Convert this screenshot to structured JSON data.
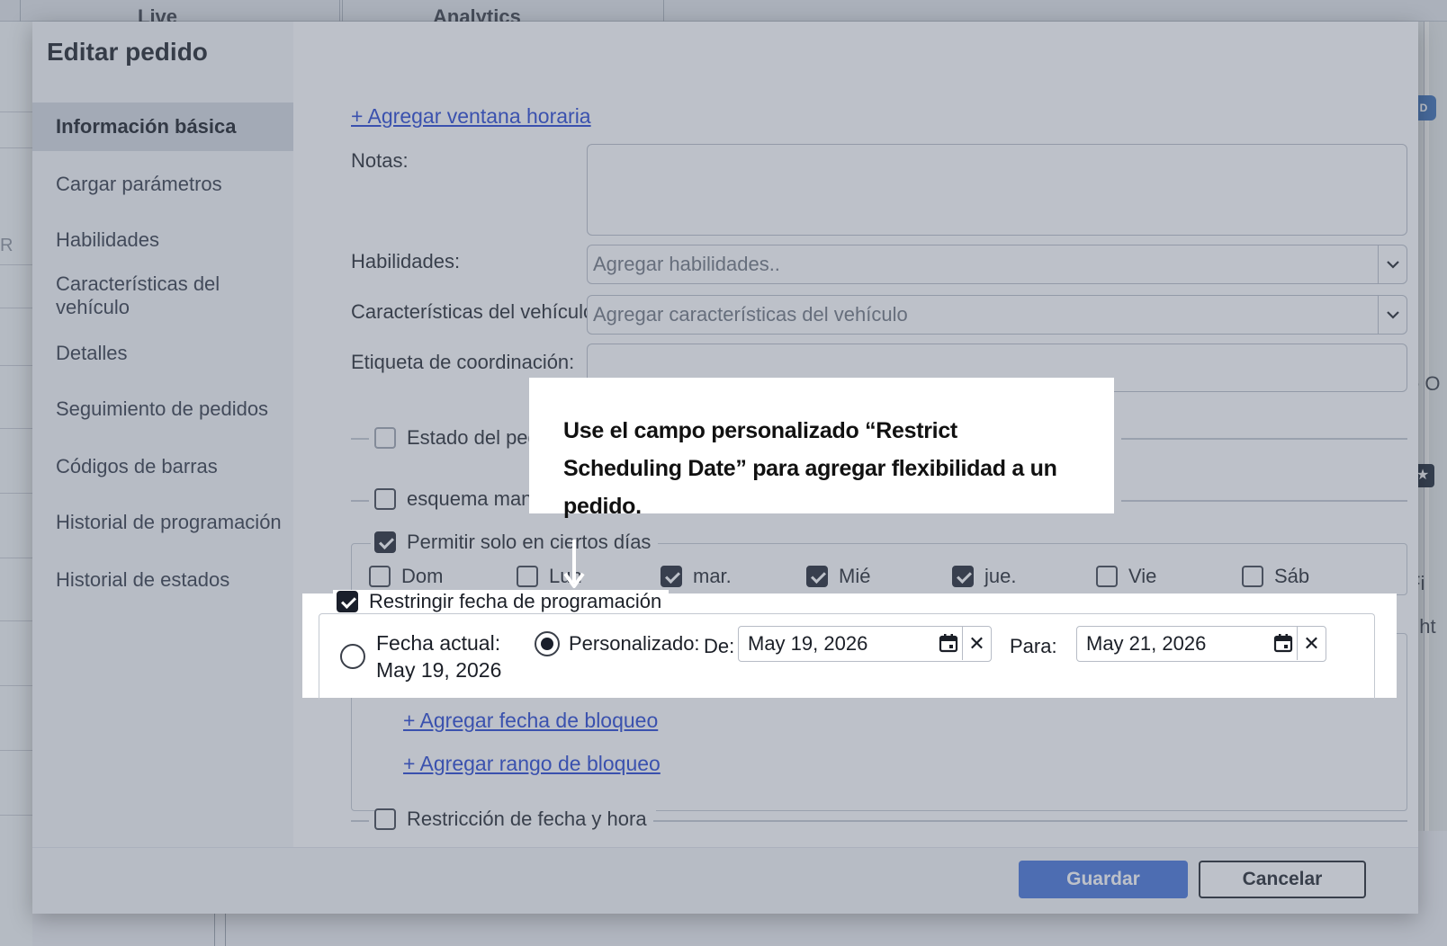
{
  "background": {
    "tabs": [
      "Live",
      "Analytics"
    ],
    "left_sliver_text": "R",
    "right_sliver_texts": [
      "e O",
      "Fi",
      "ght"
    ],
    "map_shield": "D"
  },
  "modal": {
    "title": "Editar pedido",
    "sidebar": [
      {
        "label": "Información básica",
        "active": true
      },
      {
        "label": "Cargar parámetros",
        "active": false
      },
      {
        "label": "Habilidades",
        "active": false
      },
      {
        "label": "Características del vehículo",
        "active": false
      },
      {
        "label": "Detalles",
        "active": false
      },
      {
        "label": "Seguimiento de pedidos",
        "active": false
      },
      {
        "label": "Códigos de barras",
        "active": false
      },
      {
        "label": "Historial de programación",
        "active": false
      },
      {
        "label": "Historial de estados",
        "active": false
      }
    ],
    "form": {
      "add_time_window_link": "+ Agregar ventana horaria",
      "notes_label": "Notas:",
      "notes_value": "",
      "skills_label": "Habilidades:",
      "skills_placeholder": "Agregar habilidades..",
      "vehicle_features_label": "Características del vehículo:",
      "vehicle_features_placeholder": "Agregar características del vehículo",
      "coordination_label": "Etiqueta de coordinación:",
      "coordination_value": "",
      "order_status": {
        "label": "Estado del pedido",
        "checked": false
      },
      "manual_schema": {
        "label": "esquema manual",
        "checked": false
      },
      "allow_days": {
        "label": "Permitir solo en ciertos días",
        "checked": true,
        "days": [
          {
            "label": "Dom",
            "checked": false
          },
          {
            "label": "Lun",
            "checked": false
          },
          {
            "label": "mar.",
            "checked": true
          },
          {
            "label": "Mié",
            "checked": true
          },
          {
            "label": "jue.",
            "checked": true
          },
          {
            "label": "Vie",
            "checked": false
          },
          {
            "label": "Sáb",
            "checked": false
          }
        ]
      },
      "restrict_date": {
        "label": "Restringir fecha de programación",
        "checked": true,
        "current_label": "Fecha actual:",
        "current_date": "May 19, 2026",
        "custom_label": "Personalizado:",
        "selected_option": "custom",
        "from_label": "De:",
        "from_value": "May 19, 2026",
        "to_label": "Para:",
        "to_value": "May 21, 2026",
        "add_block_date_link": "+ Agregar fecha de bloqueo",
        "add_block_range_link": "+ Agregar rango de bloqueo"
      },
      "date_time_restriction": {
        "label": "Restricción de fecha y hora",
        "checked": false
      }
    },
    "footer": {
      "save_label": "Guardar",
      "cancel_label": "Cancelar"
    }
  },
  "callout": {
    "text": "Use el campo personalizado “Restrict Scheduling Date” para agregar flexibilidad a un pedido."
  },
  "colors": {
    "primary_button": "#3f6fd8",
    "link": "#1e3fd1",
    "checkbox_checked": "#1a1f2b"
  }
}
